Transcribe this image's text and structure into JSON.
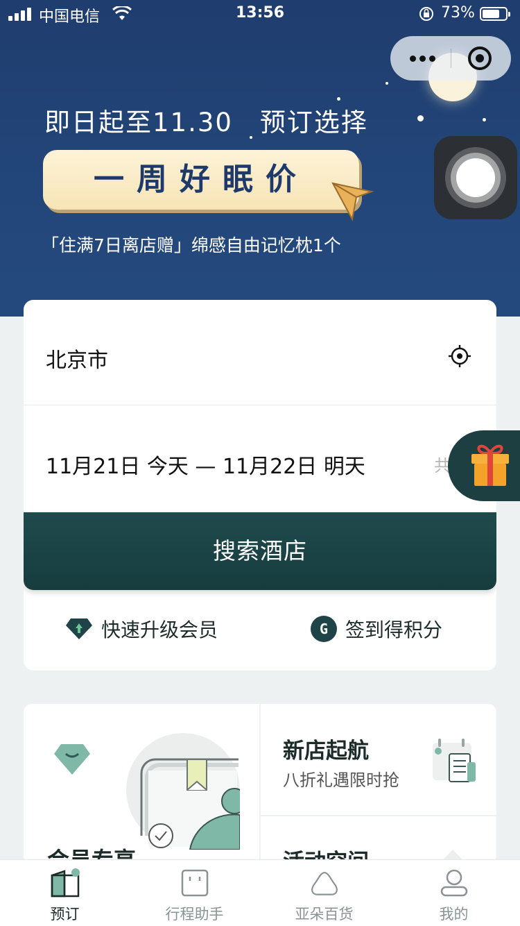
{
  "status_bar": {
    "carrier": "中国电信",
    "time": "13:56",
    "battery": "73%"
  },
  "hero": {
    "line1": "即日起至11.30　预订选择",
    "highlight": "一周好眠价",
    "line3": "「住满7日离店赠」绵感自由记忆枕1个"
  },
  "booking": {
    "city": "北京市",
    "dates": "11月21日 今天 — 11月22日 明天",
    "nights_prefix": "共",
    "search_label": "搜索酒店",
    "quick_links": [
      {
        "label": "快速升级会员",
        "icon": "upgrade-gem-icon"
      },
      {
        "label": "签到得积分",
        "icon": "g-points-icon",
        "badge": "G"
      }
    ]
  },
  "promos": {
    "member": {
      "title": "会员专享"
    },
    "new_store": {
      "title": "新店起航",
      "subtitle": "八折礼遇限时抢"
    },
    "activity": {
      "title": "活动空间"
    }
  },
  "tabbar": {
    "items": [
      {
        "label": "预订",
        "icon": "book-icon",
        "active": true
      },
      {
        "label": "行程助手",
        "icon": "itinerary-icon",
        "active": false
      },
      {
        "label": "亚朵百货",
        "icon": "store-icon",
        "active": false
      },
      {
        "label": "我的",
        "icon": "profile-icon",
        "active": false
      }
    ]
  },
  "colors": {
    "hero_bg": "#23467a",
    "primary": "#1f4b4d",
    "accent_cream": "#fbeecb",
    "mint": "#7fb8a6"
  }
}
